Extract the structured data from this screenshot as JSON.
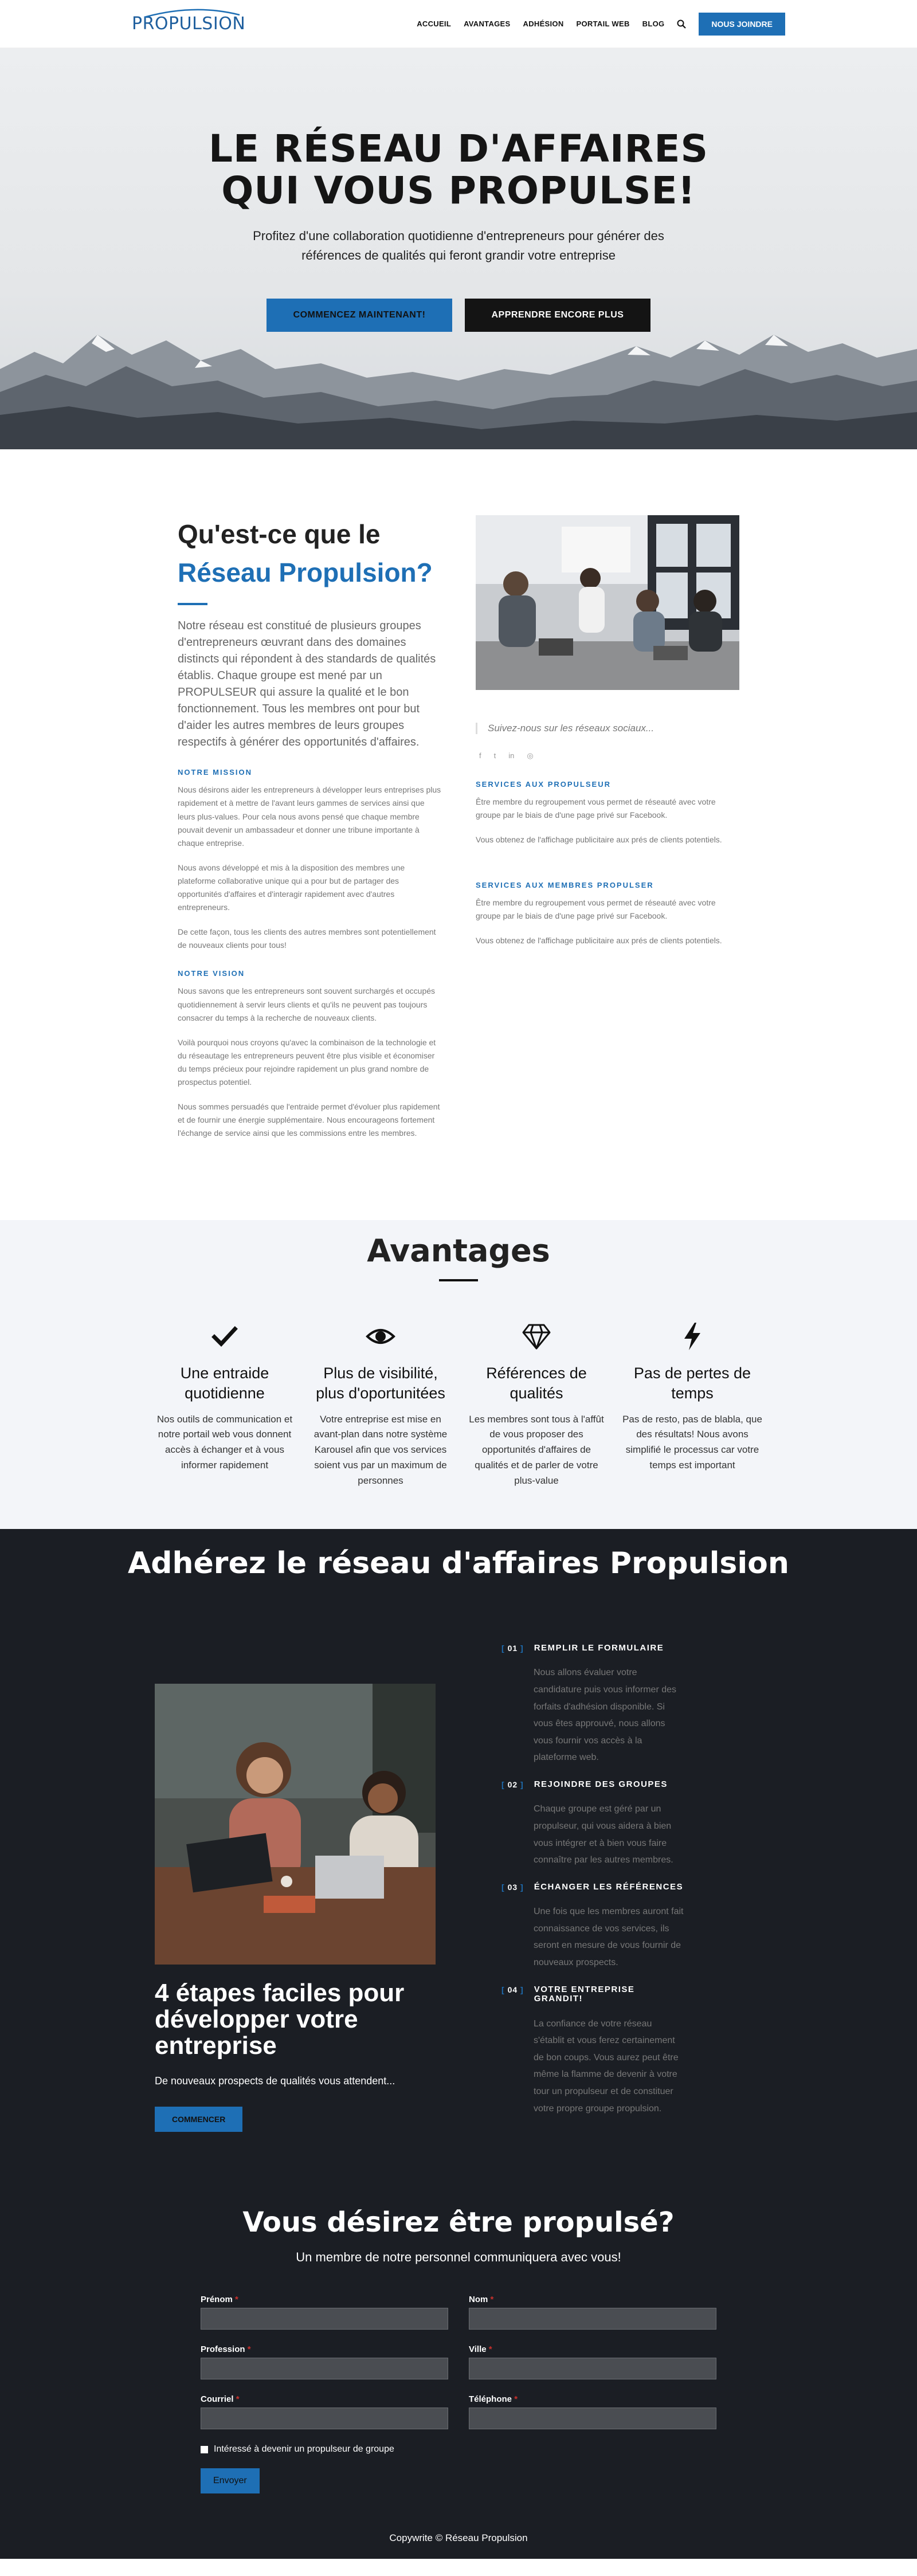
{
  "brand": {
    "logo": "PROPULSION",
    "accent": "#1e6fb5",
    "dark": "#1b1e24"
  },
  "nav": {
    "items": [
      "ACCUEIL",
      "AVANTAGES",
      "ADHÉSION",
      "PORTAIL WEB",
      "BLOG"
    ],
    "search_icon": "search-icon",
    "join_label": "NOUS JOINDRE"
  },
  "hero": {
    "title_line1": "LE RÉSEAU D'AFFAIRES",
    "title_line2": "QUI VOUS PROPULSE!",
    "subtitle": "Profitez d'une collaboration quotidienne d'entrepreneurs pour générer des références de qualités qui feront grandir votre entreprise",
    "btn_primary": "COMMENCEZ MAINTENANT!",
    "btn_secondary": "APPRENDRE ENCORE PLUS"
  },
  "about": {
    "title_line1": "Qu'est-ce que le",
    "title_line2": "Réseau Propulsion?",
    "intro": "Notre réseau est constitué de plusieurs groupes d'entrepreneurs œuvrant dans des domaines distincts qui répondent à des standards de qualités établis. Chaque groupe est mené par un PROPULSEUR qui assure la qualité et le bon fonctionnement. Tous les membres ont pour but d'aider les autres membres de leurs groupes respectifs à générer des opportunités d'affaires.",
    "mission_heading": "NOTRE MISSION",
    "mission_p1": "Nous désirons aider les entrepreneurs à développer leurs entreprises plus rapidement et à mettre de l'avant leurs gammes de services ainsi que leurs plus-values. Pour cela nous avons pensé que chaque membre pouvait devenir un ambassadeur et donner une tribune importante à chaque entreprise.",
    "mission_p2": "Nous avons développé et mis à la disposition des membres une plateforme collaborative unique qui a pour but de partager des opportunités d'affaires et d'interagir rapidement avec d'autres entrepreneurs.",
    "mission_p3": "De cette façon, tous les clients des autres membres sont potentiellement de nouveaux clients pour tous!",
    "vision_heading": "NOTRE VISION",
    "vision_p1": "Nous savons que les entrepreneurs sont souvent surchargés et occupés quotidiennement à servir leurs clients et qu'ils ne peuvent pas toujours consacrer du temps à la recherche de nouveaux clients.",
    "vision_p2": "Voilà pourquoi nous croyons qu'avec la combinaison de la technologie et du réseautage les entrepreneurs peuvent être plus visible et économiser du temps précieux pour rejoindre rapidement un plus grand nombre de prospectus potentiel.",
    "vision_p3": "Nous sommes persuadés que l'entraide permet d'évoluer plus rapidement et de fournir une énergie supplémentaire. Nous encourageons fortement l'échange de service ainsi que les commissions entre les membres.",
    "social_quote": "Suivez-nous sur les réseaux sociaux...",
    "social_icons": [
      "f",
      "t",
      "in",
      "◎"
    ],
    "services_propulseur_heading": "SERVICES AUX PROPULSEUR",
    "services_propulseur_p1": "Être membre du regroupement vous permet de réseauté avec votre groupe par le biais de d'une page privé sur Facebook.",
    "services_propulseur_p2": "Vous obtenez de l'affichage publicitaire aux prés de clients potentiels.",
    "services_membres_heading": "SERVICES AUX MEMBRES PROPULSER",
    "services_membres_p1": "Être membre du regroupement vous permet de réseauté avec votre groupe par le biais de d'une page privé sur Facebook.",
    "services_membres_p2": "Vous obtenez de l'affichage publicitaire aux prés de clients potentiels."
  },
  "avantages": {
    "title": "Avantages",
    "items": [
      {
        "icon": "check-icon",
        "title": "Une entraide quotidienne",
        "text": "Nos outils de communication et notre portail web vous donnent accès à échanger et à vous informer rapidement"
      },
      {
        "icon": "eye-icon",
        "title": "Plus de visibilité, plus d'oportunitées",
        "text": "Votre entreprise est mise en avant-plan dans notre système Karousel afin que vos services soient vus par un maximum de personnes"
      },
      {
        "icon": "diamond-icon",
        "title": "Références de qualités",
        "text": "Les membres sont tous à l'affût de vous proposer des opportunités d'affaires de qualités et de parler de votre plus-value"
      },
      {
        "icon": "bolt-icon",
        "title": "Pas de pertes de temps",
        "text": "Pas de resto, pas de blabla, que des résultats! Nous avons simplifié le processus car votre temps est important"
      }
    ]
  },
  "join": {
    "title": "Adhérez le réseau d'affaires Propulsion",
    "left_title": "4 étapes faciles pour développer votre entreprise",
    "left_text": "De nouveaux prospects de qualités vous attendent...",
    "btn": "COMMENCER",
    "steps": [
      {
        "num": "01",
        "title": "REMPLIR LE FORMULAIRE",
        "text": "Nous allons évaluer votre candidature puis vous informer des forfaits d'adhésion disponible. Si vous êtes approuvé, nous allons vous fournir vos accès à la plateforme web."
      },
      {
        "num": "02",
        "title": "REJOINDRE DES GROUPES",
        "text": "Chaque groupe est géré par un propulseur, qui vous aidera à bien vous intégrer et à bien vous faire connaître par les autres membres."
      },
      {
        "num": "03",
        "title": "ÉCHANGER LES RÉFÉRENCES",
        "text": "Une fois que les membres auront fait connaissance de vos services, ils seront en mesure de vous fournir de nouveaux prospects."
      },
      {
        "num": "04",
        "title": "VOTRE ENTREPRISE GRANDIT!",
        "text": "La confiance de votre réseau s'établit et vous ferez certainement de bon coups. Vous aurez peut être même la flamme de devenir à votre tour un propulseur et de constituer votre propre groupe propulsion."
      }
    ]
  },
  "contact": {
    "title": "Vous désirez être propulsé?",
    "subtitle": "Un membre de notre personnel communiquera avec vous!",
    "fields": {
      "prenom": "Prénom",
      "nom": "Nom",
      "profession": "Profession",
      "ville": "Ville",
      "courriel": "Courriel",
      "telephone": "Téléphone"
    },
    "required_mark": "*",
    "checkbox_label": "Intéressé à devenir un propulseur de groupe",
    "submit": "Envoyer"
  },
  "footer": {
    "copyright": "Copywrite © Réseau Propulsion"
  }
}
